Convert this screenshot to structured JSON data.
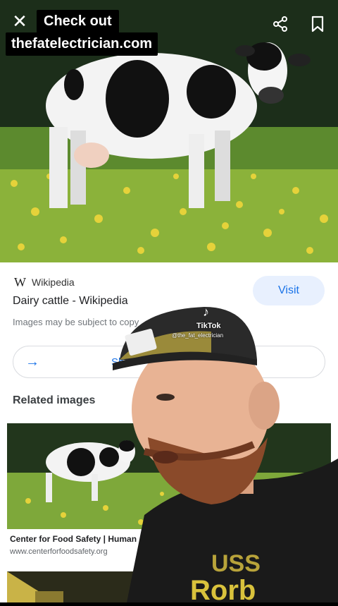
{
  "overlay": {
    "title": "Check out",
    "url": "thefatelectrician.com",
    "close_icon": "close-icon",
    "share_icon": "share-icon",
    "bookmark_icon": "bookmark-icon"
  },
  "result": {
    "source_logo": "W",
    "source": "Wikipedia",
    "visit_label": "Visit",
    "title": "Dairy cattle - Wikipedia",
    "notice": "Images may be subject to copy",
    "share_label": "Sh"
  },
  "related": {
    "heading": "Related images",
    "caption": "Center for Food Safety | Human",
    "domain": "www.centerforfoodsafety.org"
  },
  "tiktok": {
    "logo": "♪",
    "label": "TikTok",
    "handle": "@the_fat_electrician"
  },
  "colors": {
    "accent": "#1a73e8",
    "visit_bg": "#e8f0fe"
  }
}
